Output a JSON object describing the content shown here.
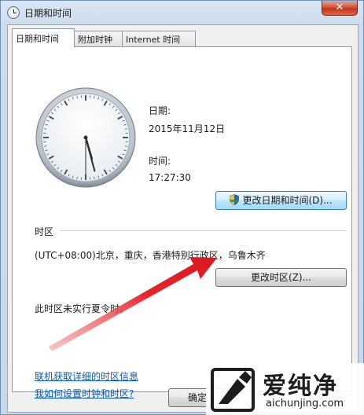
{
  "window": {
    "title": "日期和时间",
    "close_glyph": "✕"
  },
  "tabs": [
    {
      "label": "日期和时间",
      "active": true
    },
    {
      "label": "附加时钟",
      "active": false
    },
    {
      "label": "Internet 时间",
      "active": false
    }
  ],
  "datetime": {
    "date_label": "日期:",
    "date_value": "2015年11月12日",
    "time_label": "时间:",
    "time_value": "17:27:30",
    "change_button": "更改日期和时间(D)..."
  },
  "clock": {
    "hours": 17,
    "minutes": 27,
    "seconds": 30
  },
  "timezone": {
    "section_label": "时区",
    "value": "(UTC+08:00)北京，重庆，香港特别行政区，乌鲁木齐",
    "change_button": "更改时区(Z)...",
    "dst_note": "此时区未实行夏令时。"
  },
  "links": {
    "online_info": "联机获取详细的时区信息",
    "how_to": "我如何设置时钟和时区?"
  },
  "footer": {
    "ok_button": "确定"
  },
  "watermark": {
    "brand": "爱纯净",
    "url": "aichunjing.com"
  },
  "colors": {
    "link": "#0b5aa8",
    "arrow": "#e8232a",
    "close": "#c4341a"
  },
  "icons": {
    "title": "clock-icon",
    "uac": "shield-icon"
  }
}
